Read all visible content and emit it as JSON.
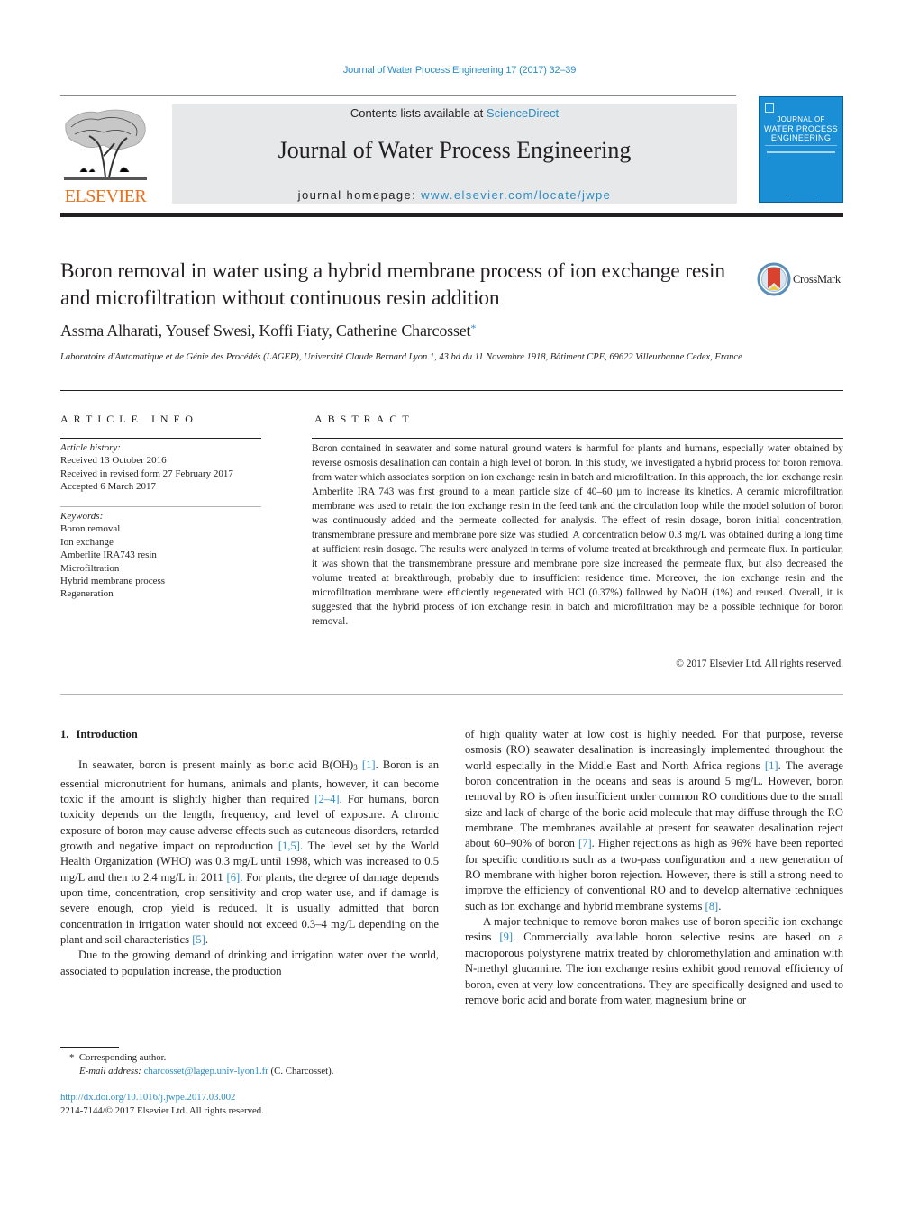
{
  "running_head": "Journal of Water Process Engineering 17 (2017) 32–39",
  "publisher": {
    "name": "ELSEVIER",
    "brand_color": "#e9711c"
  },
  "masthead": {
    "contents_prefix": "Contents lists available at ",
    "contents_link": "ScienceDirect",
    "journal_title": "Journal of Water Process Engineering",
    "homepage_prefix": "journal homepage: ",
    "homepage_link": "www.elsevier.com/locate/jwpe"
  },
  "cover": {
    "line1": "JOURNAL OF",
    "line2": "WATER PROCESS",
    "line3": "ENGINEERING",
    "color": "#1a8fd6"
  },
  "article": {
    "title": "Boron removal in water using a hybrid membrane process of ion exchange resin and microfiltration without continuous resin addition",
    "crossmark_label": "CrossMark",
    "authors": "Assma Alharati, Yousef Swesi, Koffi Fiaty, Catherine Charcosset",
    "author_mark": "*",
    "affiliation": "Laboratoire d'Automatique et de Génie des Procédés (LAGEP), Université Claude Bernard Lyon 1, 43 bd du 11 Novembre 1918, Bâtiment CPE, 69622 Villeurbanne Cedex, France"
  },
  "article_info": {
    "heading": "ARTICLE INFO",
    "history_label": "Article history:",
    "history": [
      "Received 13 October 2016",
      "Received in revised form 27 February 2017",
      "Accepted 6 March 2017"
    ],
    "keywords_label": "Keywords:",
    "keywords": [
      "Boron removal",
      "Ion exchange",
      "Amberlite IRA743 resin",
      "Microfiltration",
      "Hybrid membrane process",
      "Regeneration"
    ]
  },
  "abstract": {
    "heading": "ABSTRACT",
    "text": "Boron contained in seawater and some natural ground waters is harmful for plants and humans, especially water obtained by reverse osmosis desalination can contain a high level of boron. In this study, we investigated a hybrid process for boron removal from water which associates sorption on ion exchange resin in batch and microfiltration. In this approach, the ion exchange resin Amberlite IRA 743 was first ground to a mean particle size of 40–60 µm to increase its kinetics. A ceramic microfiltration membrane was used to retain the ion exchange resin in the feed tank and the circulation loop while the model solution of boron was continuously added and the permeate collected for analysis. The effect of resin dosage, boron initial concentration, transmembrane pressure and membrane pore size was studied. A concentration below 0.3 mg/L was obtained during a long time at sufficient resin dosage. The results were analyzed in terms of volume treated at breakthrough and permeate flux. In particular, it was shown that the transmembrane pressure and membrane pore size increased the permeate flux, but also decreased the volume treated at breakthrough, probably due to insufficient residence time. Moreover, the ion exchange resin and the microfiltration membrane were efficiently regenerated with HCl (0.37%) followed by NaOH (1%) and reused. Overall, it is suggested that the hybrid process of ion exchange resin in batch and microfiltration may be a possible technique for boron removal.",
    "copyright": "© 2017 Elsevier Ltd. All rights reserved."
  },
  "introduction": {
    "number": "1.",
    "heading": "Introduction",
    "p1": {
      "a": "In seawater, boron is present mainly as boric acid B(OH)",
      "sub": "3",
      "ref1": "[1]",
      "b": ". Boron is an essential micronutrient for humans, animals and plants, however, it can become toxic if the amount is slightly higher than required ",
      "ref2": "[2–4]",
      "c": ". For humans, boron toxicity depends on the length, frequency, and level of exposure. A chronic exposure of boron may cause adverse effects such as cutaneous disorders, retarded growth and negative impact on reproduction ",
      "ref3": "[1,5]",
      "d": ". The level set by the World Health Organization (WHO) was 0.3 mg/L until 1998, which was increased to 0.5 mg/L and then to 2.4 mg/L in 2011 ",
      "ref4": "[6]",
      "e": ". For plants, the degree of damage depends upon time, concentration, crop sensitivity and crop water use, and if damage is severe enough, crop yield is reduced. It is usually admitted that boron concentration in irrigation water should not exceed 0.3–4 mg/L depending on the plant and soil characteristics ",
      "ref5": "[5]",
      "f": "."
    },
    "p2": {
      "a": "Due to the growing demand of drinking and irrigation water over the world, associated to population increase, the production of high quality water at low cost is highly needed. For that purpose, reverse osmosis (RO) seawater desalination is increasingly implemented throughout the world especially in the Middle East and North Africa regions ",
      "ref1": "[1]",
      "b": ". The average boron concentration in the oceans and seas is around 5 mg/L. However, boron removal by RO is often insufficient under common RO conditions due to the small size and lack of charge of the boric acid molecule that may diffuse through the RO membrane. The membranes available at present for seawater desalination reject about 60–90% of boron ",
      "ref2": "[7]",
      "c": ". Higher rejections as high as 96% have been reported for specific conditions such as a two-pass configuration and a new generation of RO membrane with higher boron rejection. However, there is still a strong need to improve the efficiency of conventional RO and to develop alternative techniques such as ion exchange and hybrid membrane systems ",
      "ref3": "[8]",
      "d": "."
    },
    "p3": {
      "a": "A major technique to remove boron makes use of boron specific ion exchange resins ",
      "ref1": "[9]",
      "b": ". Commercially available boron selective resins are based on a macroporous polystyrene matrix treated by chloromethylation and amination with N-methyl glucamine. The ion exchange resins exhibit good removal efficiency of boron, even at very low concentrations. They are specifically designed and used to remove boric acid and borate from water, magnesium brine or"
    }
  },
  "footnote": {
    "mark": "*",
    "corresponding": "Corresponding author.",
    "email_label": "E-mail address:",
    "email": "charcosset@lagep.univ-lyon1.fr",
    "email_owner": "(C. Charcosset)."
  },
  "doi": "http://dx.doi.org/10.1016/j.jwpe.2017.03.002",
  "issn_line": "2214-7144/© 2017 Elsevier Ltd. All rights reserved.",
  "colors": {
    "link": "#2b8cc4",
    "masthead_bg": "#e7e8e9",
    "text": "#231f20"
  }
}
